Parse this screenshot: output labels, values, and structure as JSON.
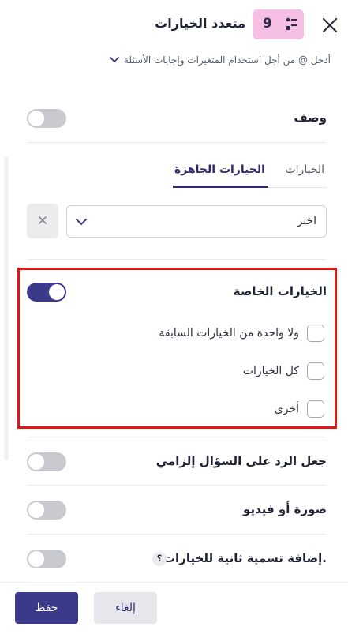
{
  "header": {
    "title": "متعدد الخيارات",
    "type_number": "9",
    "type_icon": "list-options-icon",
    "hint": "أدخل @ من أجل استخدام المتغيرات وإجابات الأسئلة"
  },
  "description": {
    "label": "وصف",
    "enabled": false
  },
  "tabs": [
    {
      "label": "الخيارات",
      "active": false
    },
    {
      "label": "الخيارات الجاهزة",
      "active": true
    }
  ],
  "ready_select": {
    "value": "اختر"
  },
  "special_options": {
    "label": "الخيارات الخاصة",
    "enabled": true,
    "items": [
      {
        "label": "ولا واحدة من الخيارات السابقة",
        "checked": false
      },
      {
        "label": "كل الخيارات",
        "checked": false
      },
      {
        "label": "أخرى",
        "checked": false
      }
    ]
  },
  "required": {
    "label": "جعل الرد على السؤال إلزامي",
    "enabled": false
  },
  "media": {
    "label": "صورة أو فيديو",
    "enabled": false
  },
  "secondary_label": {
    "label": "إضافة تسمية ثانية للخيارات.",
    "help": "؟",
    "enabled": false
  },
  "footer": {
    "save_label": "حفظ",
    "cancel_label": "إلغاء"
  },
  "colors": {
    "accent": "#3b3a8a",
    "badge_bg": "#f5c0e3",
    "highlight_border": "#e11616"
  }
}
